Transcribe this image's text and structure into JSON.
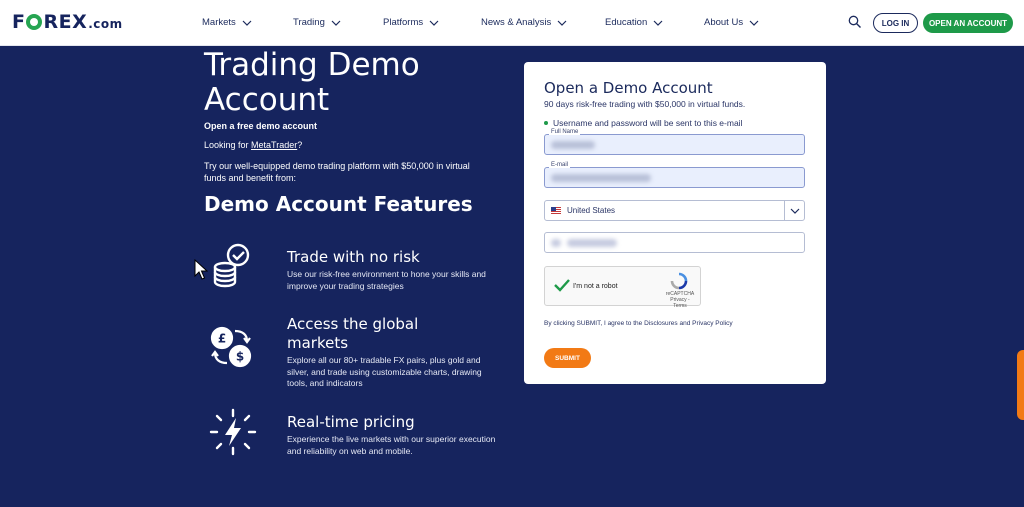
{
  "header": {
    "logo_main": "F",
    "logo_rest": "REX",
    "logo_suffix": ".com",
    "nav": [
      {
        "label": "Markets"
      },
      {
        "label": "Trading"
      },
      {
        "label": "Platforms"
      },
      {
        "label": "News & Analysis"
      },
      {
        "label": "Education"
      },
      {
        "label": "About Us"
      }
    ],
    "login_label": "LOG IN",
    "open_account_label": "OPEN AN ACCOUNT"
  },
  "hero": {
    "title": "Trading Demo Account",
    "subtitle": "Open a free demo account",
    "looking_prefix": "Looking for ",
    "looking_link": "MetaTrader",
    "looking_suffix": "?",
    "intro": "Try our well-equipped demo trading platform with $50,000 in virtual funds and benefit from:",
    "features_title": "Demo Account Features"
  },
  "features": [
    {
      "icon": "coins-check-icon",
      "title": "Trade with no risk",
      "desc": "Use our risk-free environment to hone your skills and improve your trading strategies"
    },
    {
      "icon": "currency-exchange-icon",
      "title": "Access the global markets",
      "desc": "Explore all our 80+ tradable FX pairs, plus gold and silver, and trade using customizable charts, drawing tools, and indicators"
    },
    {
      "icon": "lightning-icon",
      "title": "Real-time pricing",
      "desc": "Experience the live markets with our superior execution and reliability on web and mobile."
    }
  ],
  "form": {
    "title": "Open a Demo Account",
    "subtitle": "90 days risk-free trading with $50,000 in virtual funds.",
    "note": "Username and password will be sent to this e-mail",
    "full_name_label": "Full Name",
    "email_label": "E-mail",
    "country_value": "United States",
    "captcha_label": "I'm not a robot",
    "captcha_brand": "reCAPTCHA",
    "captcha_links": "Privacy - Terms",
    "consent_prefix": "By clicking SUBMIT, I agree to the ",
    "consent_link1": "Disclosures",
    "consent_mid": " and ",
    "consent_link2": "Privacy Policy",
    "submit_label": "SUBMIT"
  },
  "colors": {
    "background": "#16245e",
    "brand_green": "#1e9a49",
    "accent_orange": "#f27a15"
  }
}
